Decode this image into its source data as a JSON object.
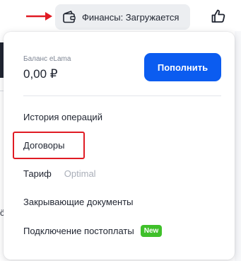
{
  "header": {
    "finance_chip_label": "Финансы: Загружается",
    "wallet_icon": "wallet-icon",
    "like_icon": "thumbs-up-icon"
  },
  "finance_menu": {
    "balance_caption": "Баланс eLama",
    "balance_value": "0,00 ₽",
    "topup_label": "Пополнить",
    "items": [
      {
        "label": "История операций"
      },
      {
        "label": "Договоры"
      },
      {
        "label": "Тариф",
        "value": "Optimal"
      },
      {
        "label": "Закрывающие документы"
      },
      {
        "label": "Подключение постоплаты",
        "badge": "New"
      }
    ]
  },
  "background": {
    "left_glyph": "ö"
  },
  "colors": {
    "primary": "#0b5cf0",
    "annotation": "#e01b24",
    "new_badge": "#3fc02a",
    "chip_bg": "#eceef1"
  }
}
